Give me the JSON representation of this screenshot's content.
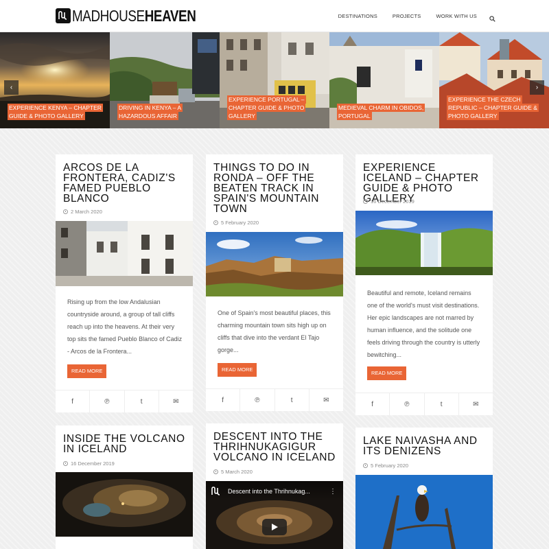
{
  "header": {
    "logo_light": "MADHOUSE",
    "logo_bold": "HEAVEN",
    "nav": [
      "DESTINATIONS",
      "PROJECTS",
      "WORK WITH US"
    ]
  },
  "slider": {
    "slides": [
      "EXPERIENCE KENYA – CHAPTER GUIDE & PHOTO GALLERY",
      "DRIVING IN KENYA – A HAZARDOUS AFFAIR",
      "EXPERIENCE PORTUGAL – CHAPTER GUIDE & PHOTO GALLERY",
      "MEDIEVAL CHARM IN OBIDOS, PORTUGAL",
      "EXPERIENCE THE CZECH REPUBLIC – CHAPTER GUIDE & PHOTO GALLERY"
    ],
    "prev_icon": "‹",
    "next_icon": "›"
  },
  "posts": [
    {
      "title": "ARCOS DE LA FRONTERA, CADIZ'S FAMED PUEBLO BLANCO",
      "date": "2 March 2020",
      "excerpt": "Rising up from the low Andalusian countryside around, a group of tall cliffs reach up into the heavens. At their very top sits the famed Pueblo Blanco of Cadiz - Arcos de la Frontera...",
      "read_more": "READ MORE"
    },
    {
      "title": "THINGS TO DO IN RONDA – OFF THE BEATEN TRACK IN SPAIN'S MOUNTAIN TOWN",
      "date": "5 February 2020",
      "excerpt": "One of Spain's most beautiful places, this charming mountain town sits high up on cliffs that dive into the verdant El Tajo gorge...",
      "read_more": "READ MORE"
    },
    {
      "title": "EXPERIENCE ICELAND – CHAPTER GUIDE & PHOTO GALLERY",
      "date": "16 December 2019",
      "excerpt": "Beautiful and remote, Iceland remains one of the world's must visit destinations. Her epic landscapes are not marred by human influence, and the solitude one feels driving through the country is utterly bewitching...",
      "read_more": "READ MORE"
    },
    {
      "title": "INSIDE THE VOLCANO IN ICELAND",
      "date": "16 December 2019"
    },
    {
      "title": "DESCENT INTO THE THRIHNUKAGIGUR VOLCANO IN ICELAND",
      "date": "5 March 2020",
      "video_title": "Descent into the Thrihnukag..."
    },
    {
      "title": "LAKE NAIVASHA AND ITS DENIZENS",
      "date": "5 February 2020"
    }
  ],
  "share": {
    "facebook": "f",
    "pinterest": "℗",
    "twitter": "t",
    "email": "✉"
  },
  "colors": {
    "accent": "#e96535"
  }
}
